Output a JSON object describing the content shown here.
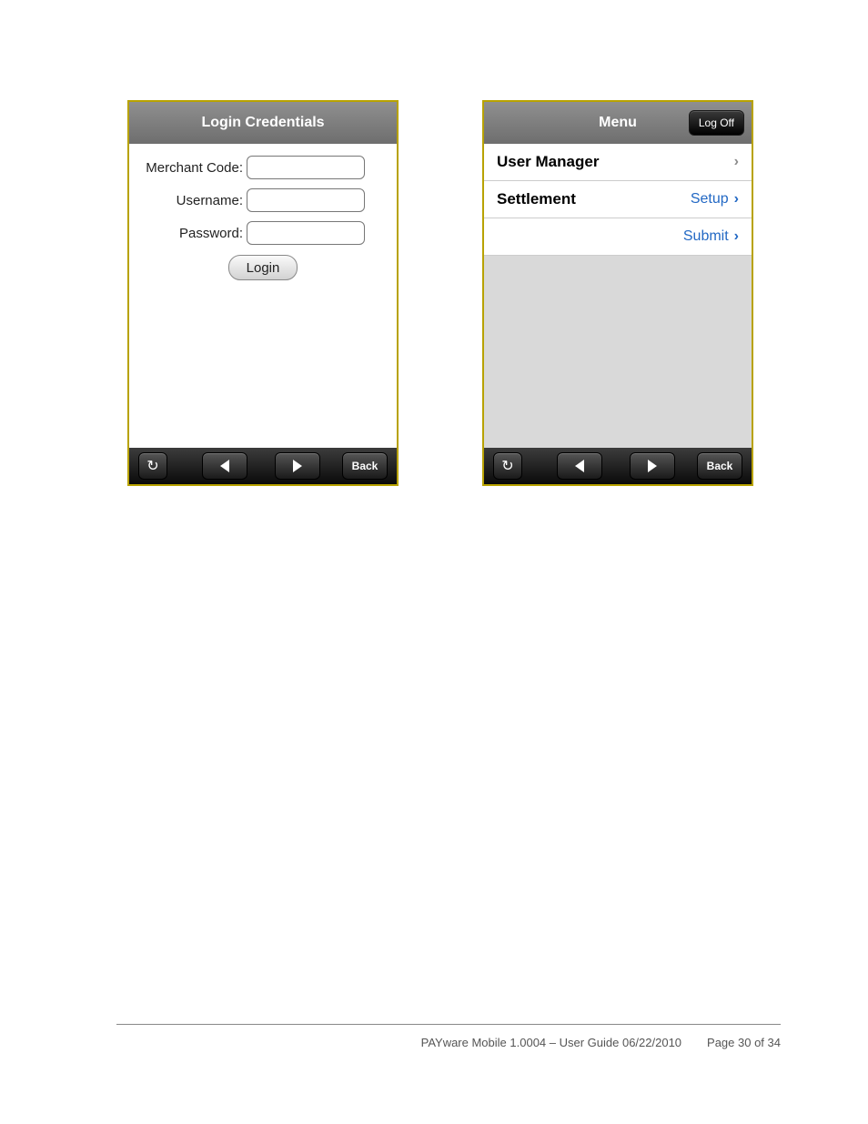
{
  "login": {
    "title": "Login Credentials",
    "merchant_label": "Merchant Code:",
    "username_label": "Username:",
    "password_label": "Password:",
    "login_btn": "Login",
    "back_btn": "Back"
  },
  "menu": {
    "title": "Menu",
    "logoff_btn": "Log Off",
    "back_btn": "Back",
    "rows": {
      "user_manager": "User Manager",
      "settlement": "Settlement",
      "setup_link": "Setup",
      "submit_link": "Submit"
    }
  },
  "footer": {
    "doc": "PAYware Mobile 1.0004 – User Guide 06/22/2010",
    "page": "Page 30 of 34"
  }
}
